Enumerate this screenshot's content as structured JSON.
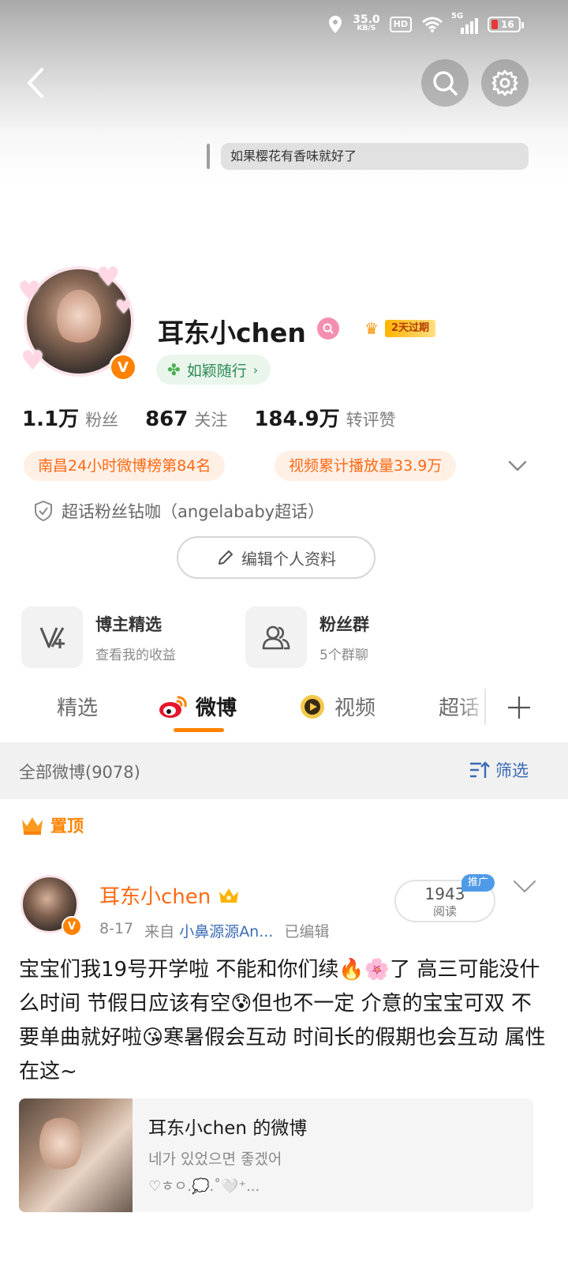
{
  "status_bar": {
    "speed_value": "35.0",
    "speed_unit": "KB/S",
    "hd": "HD",
    "network": "5G",
    "battery": "16"
  },
  "header": {
    "signature": "如果樱花有香味就好了"
  },
  "profile": {
    "name": "耳东小chen",
    "vip_label": "2天过期",
    "fan_badge": "如颖随行",
    "stats": [
      {
        "num": "1.1万",
        "label": "粉丝"
      },
      {
        "num": "867",
        "label": "关注"
      },
      {
        "num": "184.9万",
        "label": "转评赞"
      }
    ],
    "rank_tags": [
      "南昌24小时微博榜第84名",
      "视频累计播放量33.9万"
    ],
    "super_topic": "超话粉丝钻咖（angelababy超话）",
    "edit_label": "编辑个人资料"
  },
  "cards": [
    {
      "title": "博主精选",
      "subtitle": "查看我的收益",
      "icon": "v-plus-icon"
    },
    {
      "title": "粉丝群",
      "subtitle": "5个群聊",
      "icon": "group-icon"
    }
  ],
  "tabs": [
    "精选",
    "微博",
    "视频",
    "超话"
  ],
  "active_tab": "微博",
  "filter": {
    "all_count": "全部微博(9078)",
    "filter_label": "筛选"
  },
  "pinned_label": "置顶",
  "post": {
    "author": "耳东小chen",
    "date": "8-17",
    "source_prefix": "来自",
    "source": "小鼻源源An...",
    "edited": "已编辑",
    "reads": "1943",
    "reads_label": "阅读",
    "promo": "推广",
    "text": "宝宝们我19号开学啦 不能和你们续🔥🌸了 高三可能没什么时间 节假日应该有空😰但也不一定 介意的宝宝可双 不要单曲就好啦😘寒暑假会互动 时间长的假期也会互动 属性在这~",
    "share": {
      "title": "耳东小chen 的微博",
      "subtitle": "네가 있었으면 좋겠어",
      "deco": "♡ㅎㅇ.💭.˚🤍⁺..."
    }
  },
  "colors": {
    "accent": "#ff8200",
    "link": "#3b6cb5",
    "tag_bg": "#fff0e6",
    "tag_text": "#ff6a14"
  }
}
